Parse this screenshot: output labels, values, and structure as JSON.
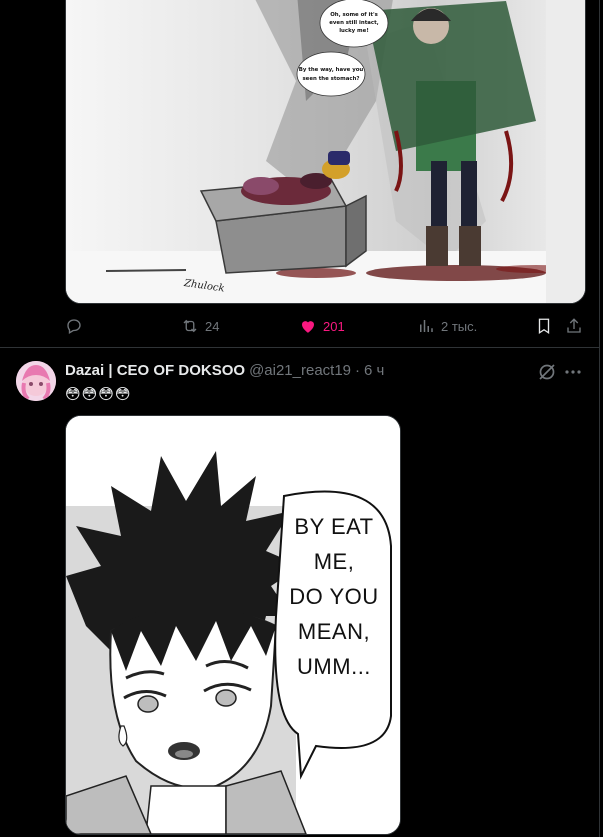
{
  "top_post": {
    "media": {
      "bubble_1": [
        "Oh, some of it's",
        "even still intact,",
        "lucky me!"
      ],
      "bubble_2": [
        "By the way, have you",
        "seen the stomach?"
      ],
      "signature": "Zhulock"
    },
    "actions": {
      "retweet_count": "24",
      "like_count": "201",
      "views_count": "2 тыс."
    }
  },
  "post": {
    "display_name": "Dazai | CEO OF DOKSOO",
    "handle": "@ai21_react19",
    "separator": "·",
    "time": "6 ч",
    "text": "😳😳😳😳",
    "media": {
      "speech_lines": [
        "BY EAT",
        "ME,",
        "DO YOU",
        "MEAN,",
        "UMM..."
      ]
    }
  },
  "colors": {
    "background": "#000000",
    "text_primary": "#e7e9ea",
    "text_secondary": "#71767b",
    "like_active": "#f91880",
    "border": "#2f3336"
  },
  "icons": [
    "reply-icon",
    "retweet-icon",
    "heart-icon",
    "views-icon",
    "bookmark-icon",
    "share-icon",
    "grok-icon",
    "more-icon"
  ]
}
